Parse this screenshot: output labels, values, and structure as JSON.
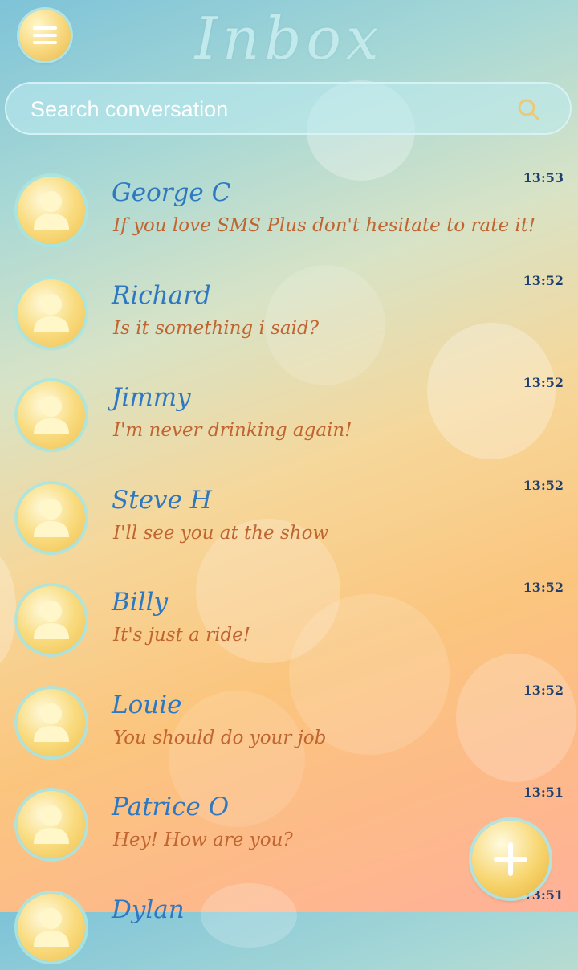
{
  "header": {
    "title": "Inbox",
    "menu_icon": "menu-icon"
  },
  "search": {
    "placeholder": "Search conversation",
    "icon": "search-icon"
  },
  "conversations": [
    {
      "name": "George C",
      "message": "If you love SMS Plus don't hesitate to rate it!",
      "time": "13:53"
    },
    {
      "name": "Richard",
      "message": "Is it something i said?",
      "time": "13:52"
    },
    {
      "name": "Jimmy",
      "message": "I'm never drinking again!",
      "time": "13:52"
    },
    {
      "name": "Steve H",
      "message": "I'll see you at the show",
      "time": "13:52"
    },
    {
      "name": "Billy",
      "message": "It's just a ride!",
      "time": "13:52"
    },
    {
      "name": "Louie",
      "message": "You should do your job",
      "time": "13:52"
    },
    {
      "name": "Patrice O",
      "message": "Hey! How are you?",
      "time": "13:51"
    },
    {
      "name": "Dylan",
      "message": "",
      "time": "13:51"
    }
  ],
  "fab": {
    "icon": "plus-icon"
  },
  "colors": {
    "name": "#2e78c2",
    "message": "#c06531",
    "time": "#1f3f6e"
  }
}
